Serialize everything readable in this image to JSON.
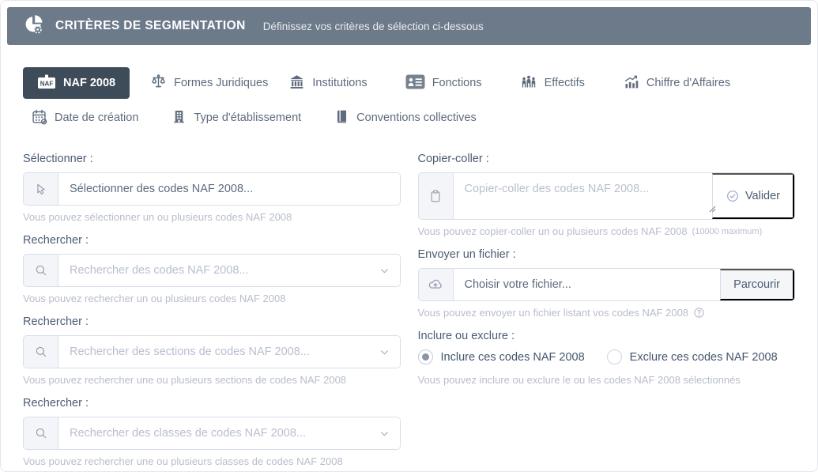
{
  "header": {
    "title": "CRITÈRES DE SEGMENTATION",
    "subtitle": "Définissez vos critères de sélection ci-dessous"
  },
  "tabs": [
    {
      "label": "NAF 2008",
      "icon": "naf-badge-icon",
      "active": true
    },
    {
      "label": "Formes Juridiques",
      "icon": "scale-icon",
      "active": false
    },
    {
      "label": "Institutions",
      "icon": "bank-icon",
      "active": false
    },
    {
      "label": "Fonctions",
      "icon": "id-card-icon",
      "active": false
    },
    {
      "label": "Effectifs",
      "icon": "people-icon",
      "active": false
    },
    {
      "label": "Chiffre d'Affaires",
      "icon": "growth-chart-icon",
      "active": false
    },
    {
      "label": "Date de création",
      "icon": "calendar-icon",
      "active": false
    },
    {
      "label": "Type d'établissement",
      "icon": "building-icon",
      "active": false
    },
    {
      "label": "Conventions collectives",
      "icon": "book-icon",
      "active": false
    }
  ],
  "left": {
    "select": {
      "label": "Sélectionner :",
      "placeholder": "Sélectionner des codes NAF 2008...",
      "helper": "Vous pouvez sélectionner un ou plusieurs codes NAF 2008"
    },
    "search_codes": {
      "label": "Rechercher :",
      "placeholder": "Rechercher des codes NAF 2008...",
      "helper": "Vous pouvez rechercher un ou plusieurs codes NAF 2008"
    },
    "search_sections": {
      "label": "Rechercher :",
      "placeholder": "Rechercher des sections de codes NAF 2008...",
      "helper": "Vous pouvez rechercher une ou plusieurs sections de codes NAF 2008"
    },
    "search_classes": {
      "label": "Rechercher :",
      "placeholder": "Rechercher des classes de codes NAF 2008...",
      "helper": "Vous pouvez rechercher une ou plusieurs classes de codes NAF 2008"
    }
  },
  "right": {
    "paste": {
      "label": "Copier-coller :",
      "placeholder": "Copier-coller des codes NAF 2008...",
      "button": "Valider",
      "helper": "Vous pouvez copier-coller un ou plusieurs codes NAF 2008",
      "helper_note": "(10000 maximum)"
    },
    "file": {
      "label": "Envoyer un fichier :",
      "placeholder": "Choisir votre fichier...",
      "button": "Parcourir",
      "helper": "Vous pouvez envoyer un fichier listant vos codes NAF 2008"
    },
    "include": {
      "label": "Inclure ou exclure :",
      "options": [
        {
          "label": "Inclure ces codes NAF 2008",
          "selected": true
        },
        {
          "label": "Exclure ces codes NAF 2008",
          "selected": false
        }
      ],
      "helper": "Vous pouvez inclure ou exclure le ou les codes NAF 2008 sélectionnés"
    }
  },
  "colors": {
    "header_bg": "#6d7a89",
    "active_tab_bg": "#3e4b59",
    "label_text": "#4b5c72",
    "helper_text": "#b7bdcb",
    "border": "#d9dee8",
    "accent_check": "#a9b1d4"
  }
}
